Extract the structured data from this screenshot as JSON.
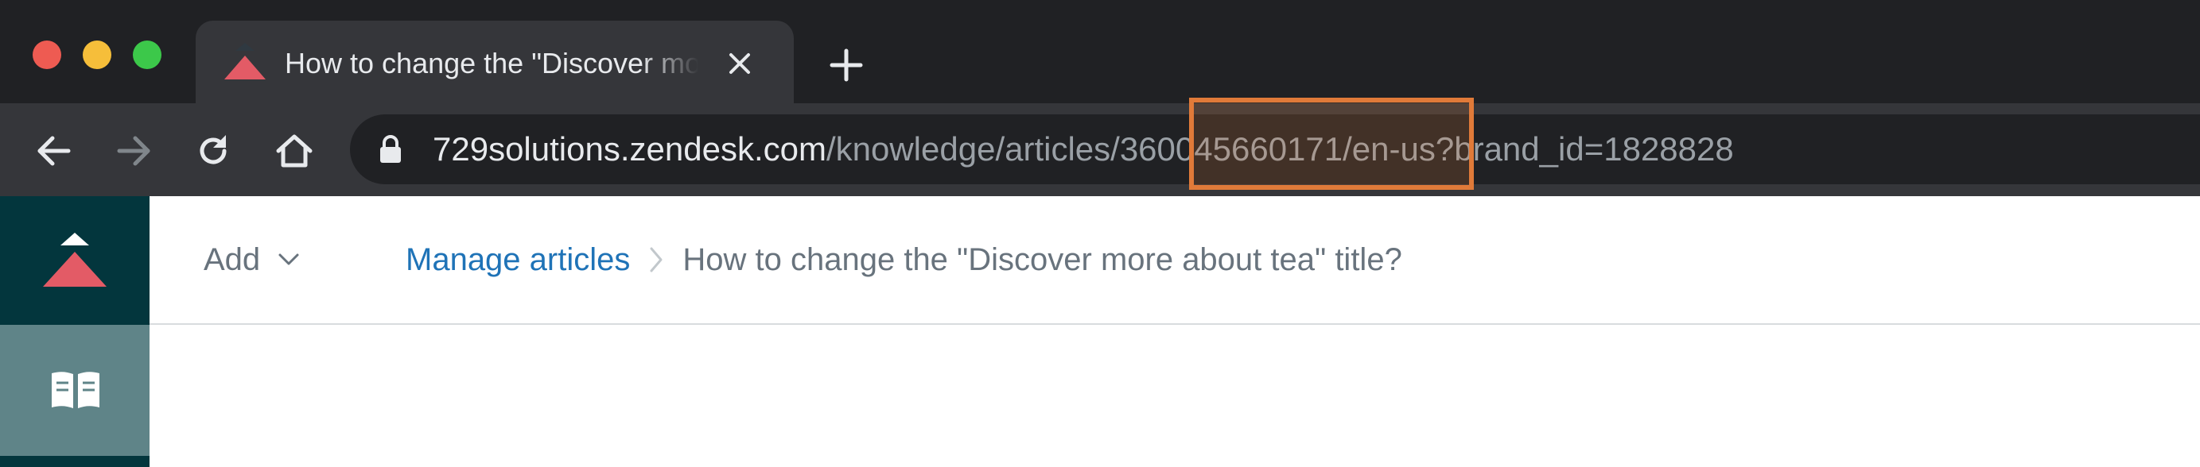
{
  "browser": {
    "tab": {
      "title": "How to change the \"Discover more about tea\" title?"
    },
    "address_bar": {
      "host": "729solutions.zendesk.com",
      "path_before": "/knowledge/articles",
      "path_highlighted": "/360045660171",
      "path_after": "/en-us?brand_id=1828828"
    },
    "highlight_color": "#e07a39"
  },
  "app": {
    "header": {
      "add_label": "Add",
      "breadcrumb": {
        "link": "Manage articles",
        "current": "How to change the \"Discover more about tea\" title?"
      }
    },
    "rail": {
      "items": [
        {
          "icon": "zendesk-guide-logo-icon"
        },
        {
          "icon": "open-book-icon"
        }
      ]
    },
    "colors": {
      "rail": "#03363d",
      "rail_active": "#5f8488",
      "logo_top": "#ffffff",
      "logo_bottom": "#e35b66",
      "link": "#1f73b7",
      "muted_text": "#68737d"
    }
  }
}
